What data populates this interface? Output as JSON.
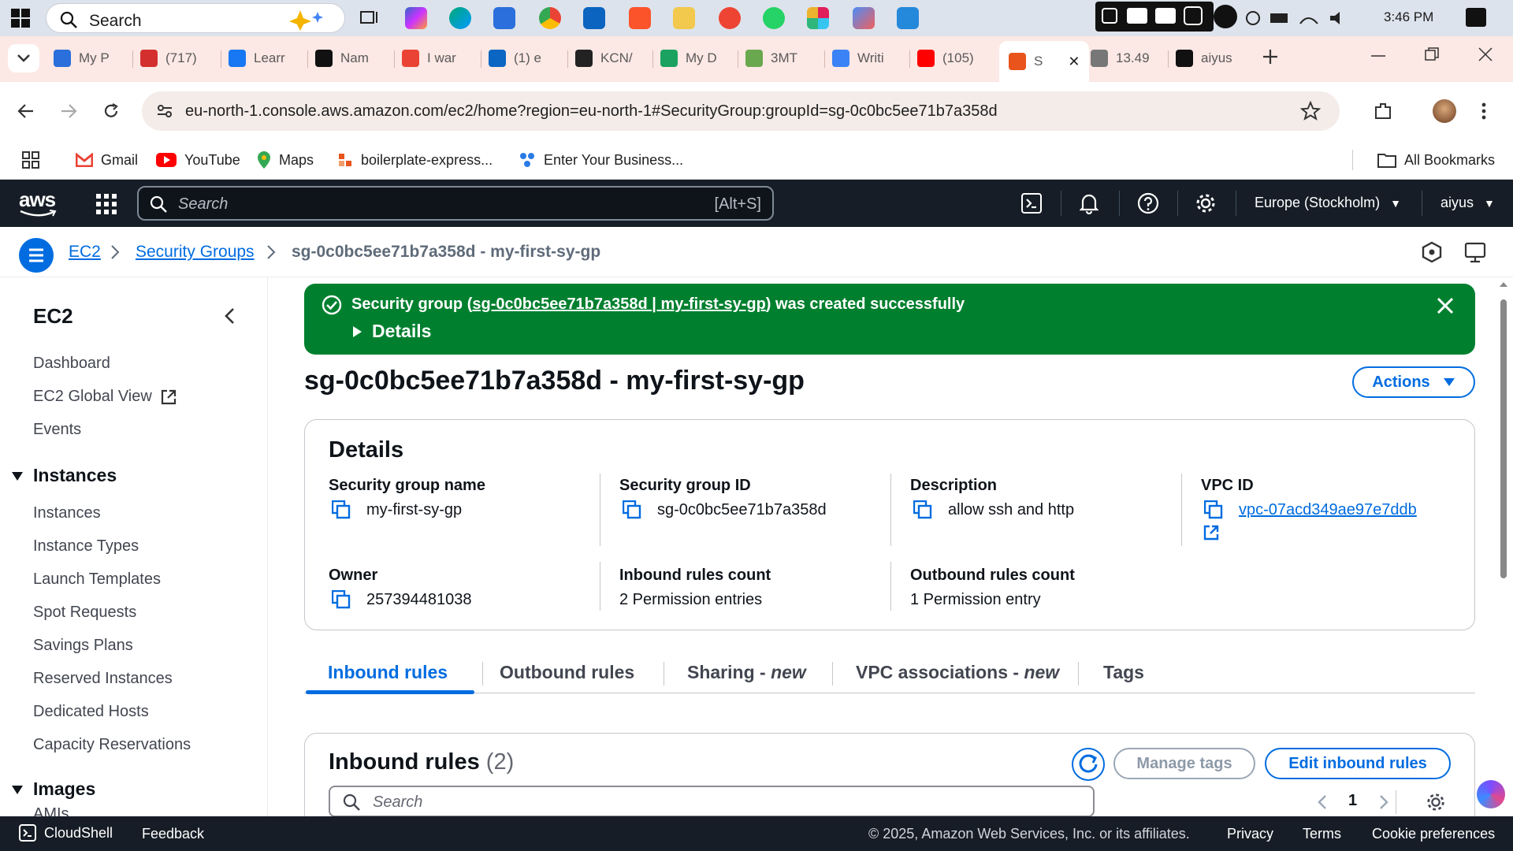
{
  "taskbar": {
    "search_placeholder": "Search",
    "clock": "3:46 PM"
  },
  "browser": {
    "tabs": [
      {
        "label": "My P",
        "icon": "page-icon"
      },
      {
        "label": "(717)",
        "icon": "mail-icon"
      },
      {
        "label": "Learr",
        "icon": "learn-icon"
      },
      {
        "label": "Nam",
        "icon": "openai-icon"
      },
      {
        "label": "I war",
        "icon": "gmail-icon"
      },
      {
        "label": "(1) e",
        "icon": "linkedin-icon"
      },
      {
        "label": "KCN/",
        "icon": "app-icon"
      },
      {
        "label": "My D",
        "icon": "drive-icon"
      },
      {
        "label": "3MT",
        "icon": "grid-icon"
      },
      {
        "label": "Writi",
        "icon": "write-icon"
      },
      {
        "label": "(105)",
        "icon": "youtube-icon"
      },
      {
        "label": "S",
        "icon": "aws-icon"
      },
      {
        "label": "13.49",
        "icon": "globe-icon"
      },
      {
        "label": "aiyus",
        "icon": "github-icon"
      }
    ],
    "url": "eu-north-1.console.aws.amazon.com/ec2/home?region=eu-north-1#SecurityGroup:groupId=sg-0c0bc5ee71b7a358d",
    "bookmarks": [
      "Gmail",
      "YouTube",
      "Maps",
      "boilerplate-express...",
      "Enter Your Business..."
    ],
    "all_bookmarks": "All Bookmarks"
  },
  "aws_header": {
    "logo": "aws",
    "search_placeholder": "Search",
    "search_shortcut": "[Alt+S]",
    "region": "Europe (Stockholm)",
    "user": "aiyus"
  },
  "breadcrumb": {
    "items": [
      "EC2",
      "Security Groups"
    ],
    "current": "sg-0c0bc5ee71b7a358d - my-first-sy-gp"
  },
  "sidenav": {
    "title": "EC2",
    "top_items": [
      "Dashboard",
      "EC2 Global View",
      "Events"
    ],
    "instances_section": "Instances",
    "instances_items": [
      "Instances",
      "Instance Types",
      "Launch Templates",
      "Spot Requests",
      "Savings Plans",
      "Reserved Instances",
      "Dedicated Hosts",
      "Capacity Reservations"
    ],
    "images_section": "Images",
    "images_items": [
      "AMIs"
    ]
  },
  "flash": {
    "prefix": "Security group (",
    "link": "sg-0c0bc5ee71b7a358d | my-first-sy-gp",
    "suffix": ") was created successfully",
    "details": "Details"
  },
  "page": {
    "title": "sg-0c0bc5ee71b7a358d - my-first-sy-gp",
    "actions_label": "Actions"
  },
  "details": {
    "heading": "Details",
    "sg_name_label": "Security group name",
    "sg_name": "my-first-sy-gp",
    "sg_id_label": "Security group ID",
    "sg_id": "sg-0c0bc5ee71b7a358d",
    "description_label": "Description",
    "description": "allow ssh and http",
    "vpc_label": "VPC ID",
    "vpc_id": "vpc-07acd349ae97e7ddb",
    "owner_label": "Owner",
    "owner": "257394481038",
    "inbound_count_label": "Inbound rules count",
    "inbound_count": "2 Permission entries",
    "outbound_count_label": "Outbound rules count",
    "outbound_count": "1 Permission entry"
  },
  "tabs": {
    "inbound": "Inbound rules",
    "outbound": "Outbound rules",
    "sharing": "Sharing -",
    "sharing_new": "new",
    "vpc_assoc": "VPC associations -",
    "vpc_assoc_new": "new",
    "tags": "Tags"
  },
  "inbound_panel": {
    "title": "Inbound rules",
    "count": "(2)",
    "manage_tags": "Manage tags",
    "edit_rules": "Edit inbound rules",
    "search_placeholder": "Search",
    "page": "1"
  },
  "footer": {
    "cloudshell": "CloudShell",
    "feedback": "Feedback",
    "copyright": "© 2025, Amazon Web Services, Inc. or its affiliates.",
    "privacy": "Privacy",
    "terms": "Terms",
    "cookies": "Cookie preferences"
  },
  "colors": {
    "aws_dark": "#161d26",
    "link_blue": "#006ce0",
    "success_green": "#00802f"
  }
}
